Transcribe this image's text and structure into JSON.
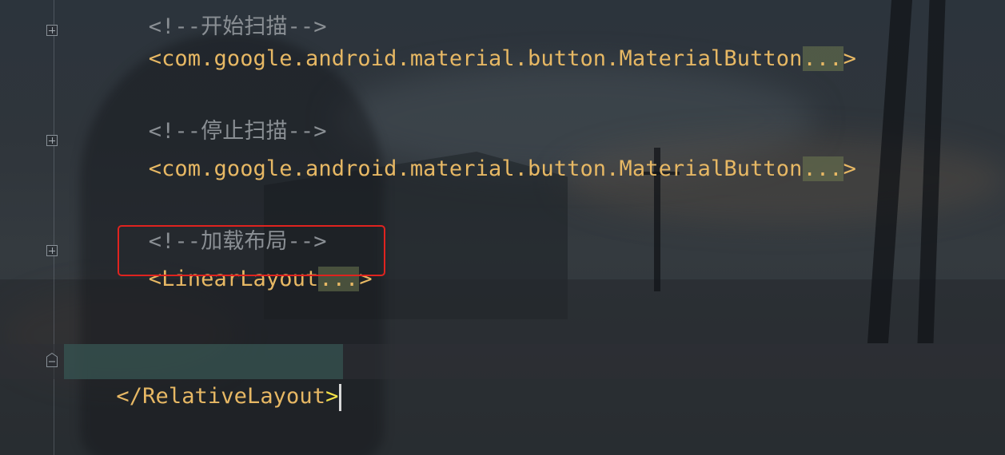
{
  "editor": {
    "lines": [
      {
        "id": "comment_start",
        "text": "<!--开始扫描-->",
        "kind": "comment"
      },
      {
        "id": "button1",
        "prefix": "<com.google.android.material.button.MaterialButton",
        "ellipsis": "...",
        "suffix": ">",
        "folded": true
      },
      {
        "id": "comment_stop",
        "text": "<!--停止扫描-->",
        "kind": "comment"
      },
      {
        "id": "button2",
        "prefix": "<com.google.android.material.button.MaterialButton",
        "ellipsis": "...",
        "suffix": ">",
        "folded": true
      },
      {
        "id": "comment_layout",
        "text": "<!--加载布局-->",
        "kind": "comment"
      },
      {
        "id": "linear",
        "prefix": "<LinearLayout",
        "ellipsis": "...",
        "suffix": ">",
        "folded": true,
        "highlighted": true
      },
      {
        "id": "closing",
        "open": "</RelativeLayout",
        "close": ">"
      }
    ]
  },
  "colors": {
    "tag": "#e7b864",
    "comment": "#8a8f94",
    "highlight_border": "#e0231f",
    "bracket_match": "#f4e247"
  },
  "icons": {
    "fold_expand": "plus-box-icon",
    "fold_collapse": "minus-box-icon"
  }
}
